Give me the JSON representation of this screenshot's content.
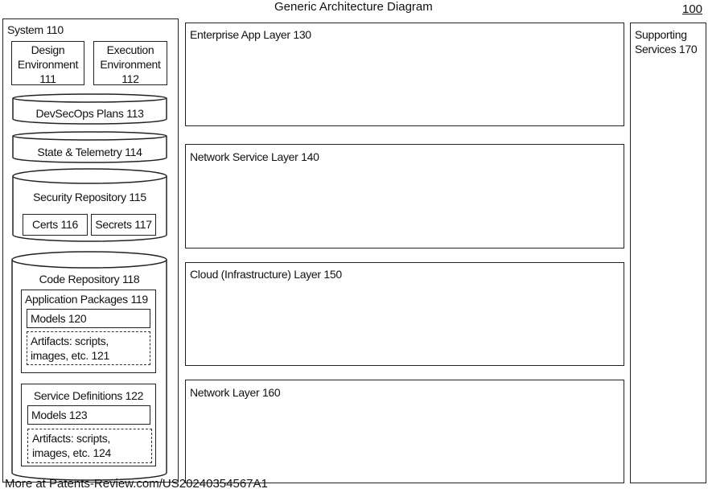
{
  "title": "Generic Architecture Diagram",
  "figure_number": "100",
  "system": {
    "label": "System 110",
    "design_env": [
      "Design",
      "Environment",
      "111"
    ],
    "execution_env": [
      "Execution",
      "Environment",
      "112"
    ],
    "devsecops": "DevSecOps Plans 113",
    "state_telemetry": "State & Telemetry 114",
    "security_repo": {
      "label": "Security Repository 115",
      "certs": "Certs 116",
      "secrets": "Secrets 117"
    },
    "code_repo": {
      "label": "Code Repository 118",
      "app_packages": {
        "label": "Application Packages 119",
        "models": "Models 120",
        "artifacts": [
          "Artifacts: scripts,",
          "images, etc. 121"
        ]
      },
      "service_defs": {
        "label": "Service Definitions 122",
        "models": "Models 123",
        "artifacts": [
          "Artifacts: scripts,",
          "images, etc. 124"
        ]
      }
    }
  },
  "layers": [
    "Enterprise App Layer 130",
    "Network Service Layer 140",
    "Cloud (Infrastructure) Layer 150",
    "Network Layer 160"
  ],
  "supporting_services": [
    "Supporting",
    "Services 170"
  ],
  "footer": "More at Patents-Review.com/US20240354567A1"
}
